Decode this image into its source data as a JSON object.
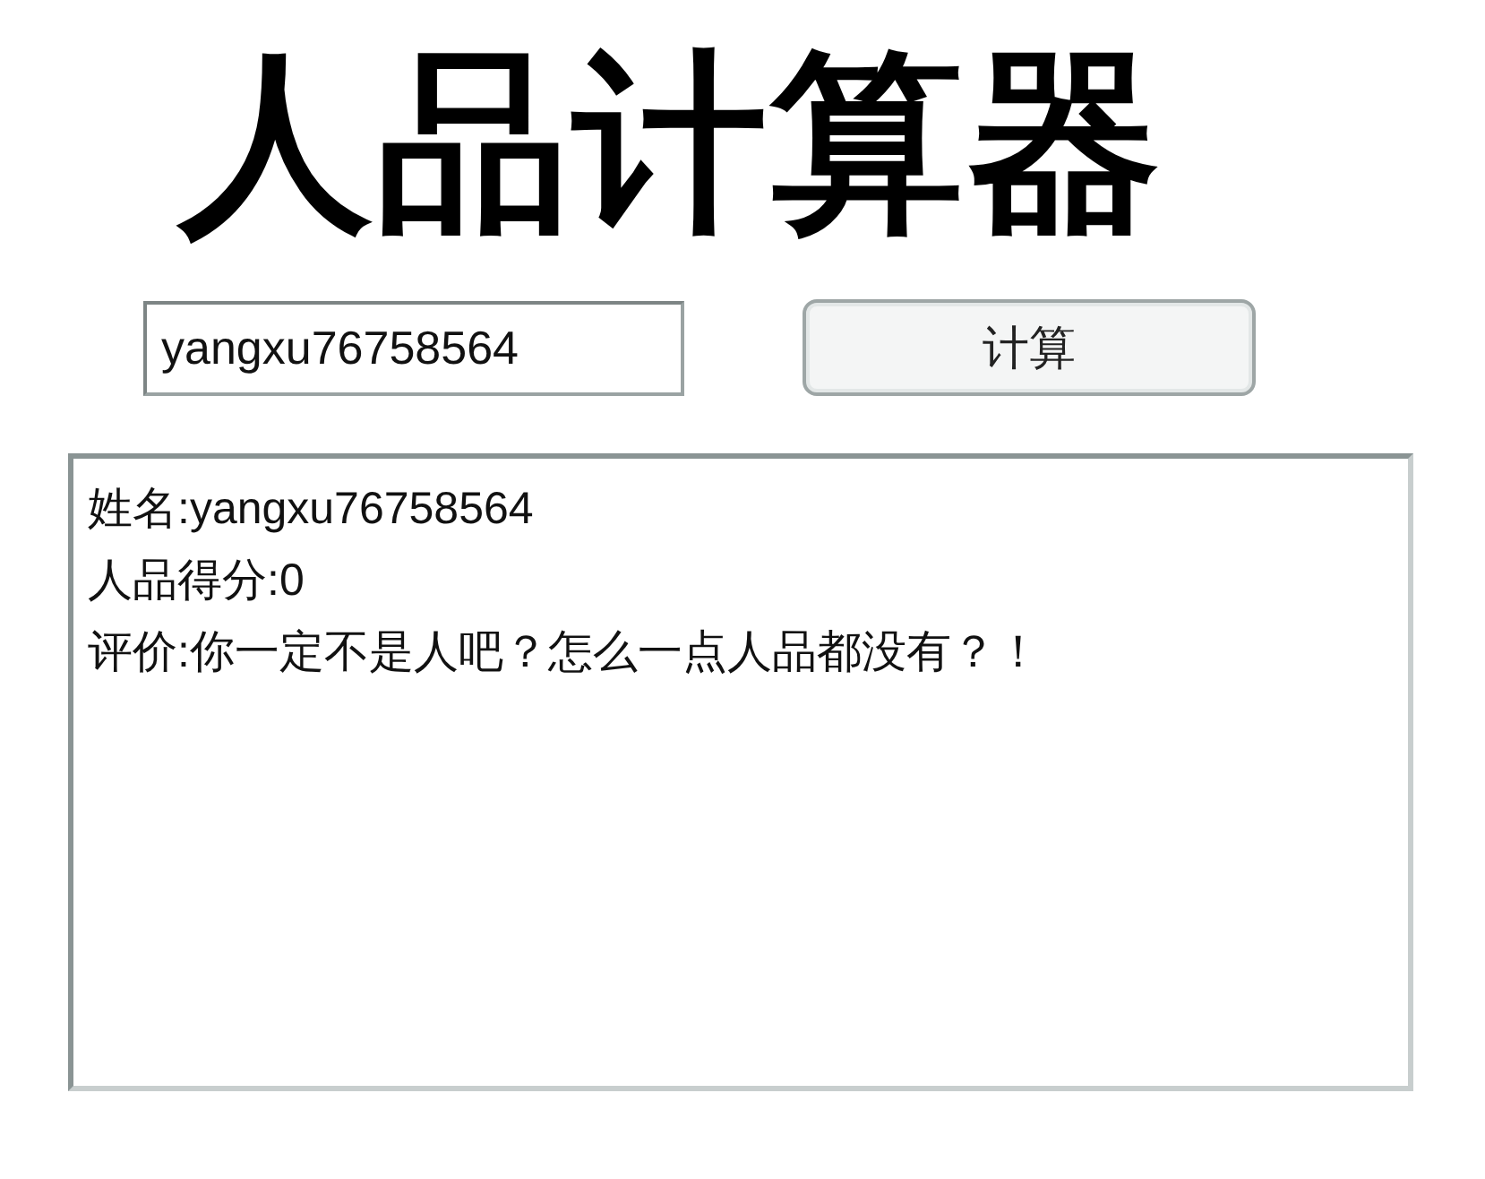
{
  "title": "人品计算器",
  "name_field": {
    "value": "yangxu76758564"
  },
  "calculate_button": {
    "label": "计算"
  },
  "result": {
    "lines": [
      "姓名:yangxu76758564",
      "人品得分:0",
      "评价:你一定不是人吧？怎么一点人品都没有？！"
    ]
  }
}
